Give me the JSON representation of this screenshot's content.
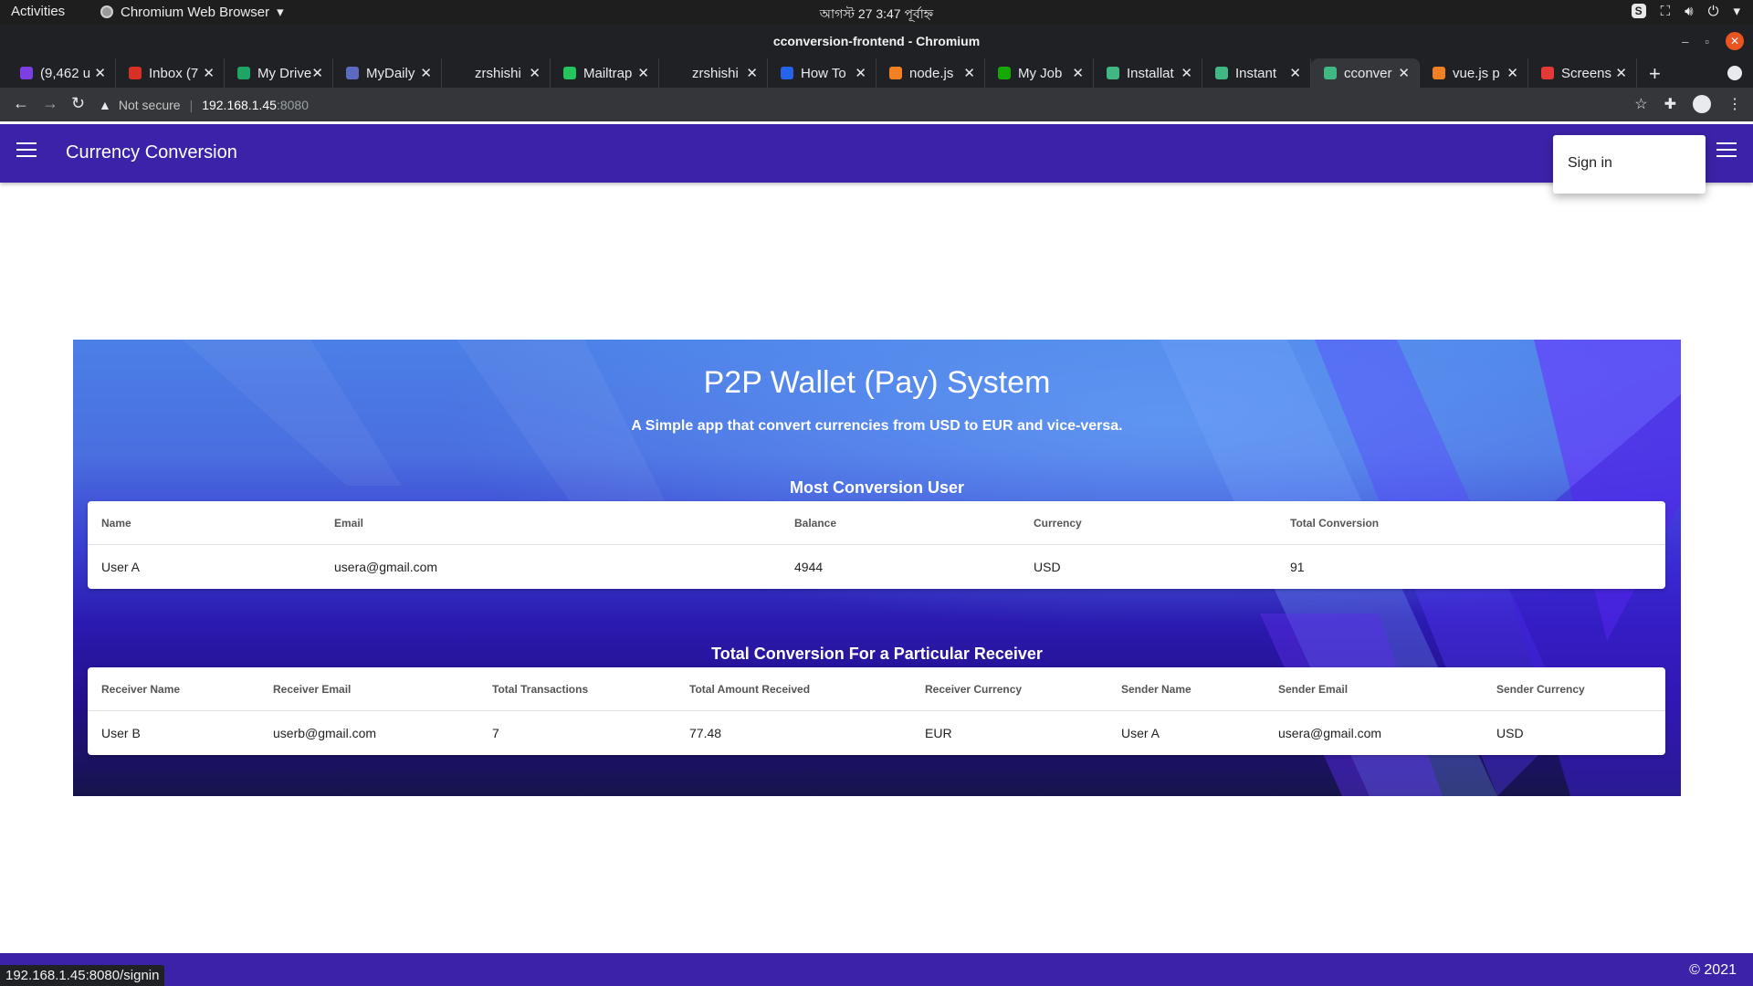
{
  "system": {
    "activities": "Activities",
    "app_name": "Chromium Web Browser",
    "clock": "আগস্ট 27  3:47 পূর্বাহ্ন"
  },
  "window": {
    "title": "cconversion-frontend - Chromium"
  },
  "tabs": [
    {
      "label": "(9,462 u",
      "icon_color": "#7b3fe4",
      "active": false
    },
    {
      "label": "Inbox (7",
      "icon_color": "#d93025",
      "active": false
    },
    {
      "label": "My Drive",
      "icon_color": "#1fa463",
      "active": false
    },
    {
      "label": "MyDaily",
      "icon_color": "#5c6bc0",
      "active": false
    },
    {
      "label": "zrshishi",
      "icon_color": "#202124",
      "active": false
    },
    {
      "label": "Mailtrap",
      "icon_color": "#22c55e",
      "active": false
    },
    {
      "label": "zrshishi",
      "icon_color": "#202124",
      "active": false
    },
    {
      "label": "How To",
      "icon_color": "#2563eb",
      "active": false
    },
    {
      "label": "node.js",
      "icon_color": "#f48024",
      "active": false
    },
    {
      "label": "My Job",
      "icon_color": "#14a800",
      "active": false
    },
    {
      "label": "Installat",
      "icon_color": "#41b883",
      "active": false
    },
    {
      "label": "Instant",
      "icon_color": "#41b883",
      "active": false
    },
    {
      "label": "cconver",
      "icon_color": "#41b883",
      "active": true
    },
    {
      "label": "vue.js p",
      "icon_color": "#f48024",
      "active": false
    },
    {
      "label": "Screens",
      "icon_color": "#e53935",
      "active": false
    }
  ],
  "addressbar": {
    "security": "Not secure",
    "host": "192.168.1.45",
    "port": ":8080"
  },
  "app": {
    "title": "Currency Conversion",
    "signin_label": "Sign in",
    "brand_color": "#3c22a8"
  },
  "hero": {
    "title": "P2P Wallet (Pay) System",
    "subtitle": "A Simple app that convert currencies from USD to EUR and vice-versa."
  },
  "most_conversion": {
    "title": "Most Conversion User",
    "headers": [
      "Name",
      "Email",
      "Balance",
      "Currency",
      "Total Conversion"
    ],
    "rows": [
      [
        "User A",
        "usera@gmail.com",
        "4944",
        "USD",
        "91"
      ]
    ]
  },
  "receiver_conversion": {
    "title": "Total Conversion For a Particular Receiver",
    "headers": [
      "Receiver Name",
      "Receiver Email",
      "Total Transactions",
      "Total Amount Received",
      "Receiver Currency",
      "Sender Name",
      "Sender Email",
      "Sender Currency"
    ],
    "rows": [
      [
        "User B",
        "userb@gmail.com",
        "7",
        "77.48",
        "EUR",
        "User A",
        "usera@gmail.com",
        "USD"
      ]
    ]
  },
  "footer": {
    "copyright": "© 2021"
  },
  "status_url": "192.168.1.45:8080/signin"
}
